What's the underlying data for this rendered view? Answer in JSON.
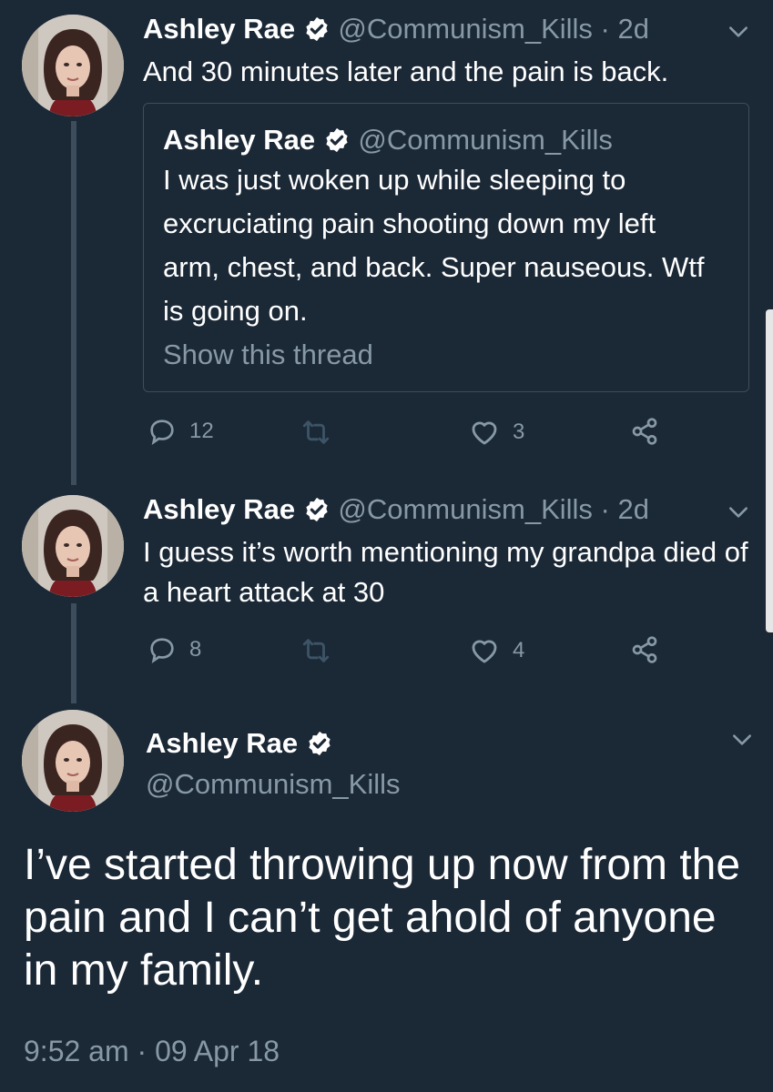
{
  "tweets": [
    {
      "name": "Ashley Rae",
      "handle": "@Communism_Kills",
      "sep": "·",
      "time": "2d",
      "text": "And 30 minutes later and the pain is back.",
      "quote": {
        "name": "Ashley Rae",
        "handle": "@Communism_Kills",
        "text": "I was just woken up while sleeping to excruciating pain shooting down my left arm, chest, and back. Super nauseous. Wtf is going on.",
        "show_thread": "Show this thread"
      },
      "replies": "12",
      "likes": "3"
    },
    {
      "name": "Ashley Rae",
      "handle": "@Communism_Kills",
      "sep": "·",
      "time": "2d",
      "text": "I guess it’s worth mentioning my grandpa died of a heart attack at 30",
      "replies": "8",
      "likes": "4"
    }
  ],
  "main": {
    "name": "Ashley Rae",
    "handle": "@Communism_Kills",
    "text": "I’ve started throwing up now from the pain and I can’t get ahold of anyone in my family.",
    "timestamp": "9:52 am · 09 Apr 18"
  },
  "icons": {
    "verified": "verified-badge-icon",
    "caret": "chevron-down-icon",
    "reply": "reply-icon",
    "retweet": "retweet-icon",
    "like": "heart-icon",
    "share": "share-icon"
  },
  "colors": {
    "background": "#1b2836",
    "muted": "#8899a6",
    "thread_line": "#3d4d5c"
  }
}
